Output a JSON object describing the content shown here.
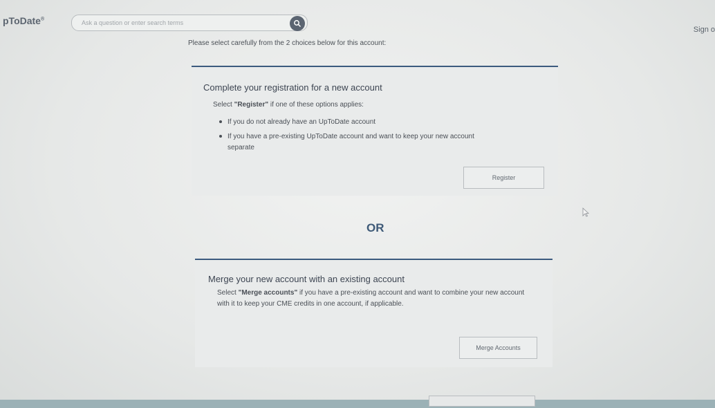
{
  "header": {
    "logo_text": "pToDate",
    "logo_mark": "®",
    "search_placeholder": "Ask a question or enter search terms",
    "search_icon": "search-icon",
    "signin_label": "Sign o"
  },
  "intro_text": "Please select carefully from the 2 choices below for this account:",
  "register_card": {
    "title": "Complete your registration for a new account",
    "lead_prefix": "Select ",
    "lead_strong": "\"Register\"",
    "lead_suffix": " if one of these options applies:",
    "bullets": [
      "If you do not already have an UpToDate account",
      "If you have a pre-existing UpToDate account and want to keep your new account",
      "separate"
    ],
    "button_label": "Register"
  },
  "separator_text": "OR",
  "merge_card": {
    "title": "Merge your new account with an existing account",
    "desc_prefix": "Select ",
    "desc_strong": "\"Merge accounts\"",
    "desc_suffix": " if you have a pre-existing account and want to combine your new account with it to keep your CME credits in one account, if applicable.",
    "button_label": "Merge Accounts"
  },
  "colors": {
    "accent": "#3b5a7e",
    "card_bg": "#e9ebeb"
  }
}
